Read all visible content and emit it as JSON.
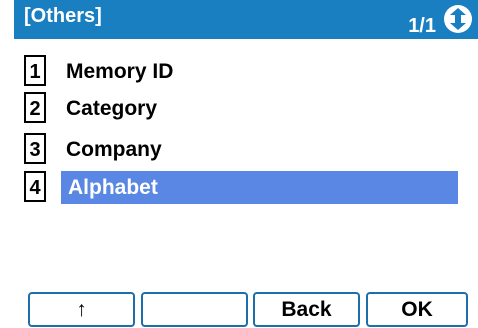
{
  "header": {
    "title": "[Others]",
    "page_indicator": "1/1",
    "scroll_icon": "up-down-scroll-icon"
  },
  "menu": {
    "items": [
      {
        "number": "1",
        "label": "Memory ID",
        "selected": false
      },
      {
        "number": "2",
        "label": "Category",
        "selected": false
      },
      {
        "number": "3",
        "label": "Company",
        "selected": false
      },
      {
        "number": "4",
        "label": "Alphabet",
        "selected": true
      }
    ]
  },
  "softkeys": [
    {
      "label": "↑"
    },
    {
      "label": ""
    },
    {
      "label": "Back"
    },
    {
      "label": "OK"
    }
  ],
  "colors": {
    "header_bg": "#1a7fc0",
    "selection_bg": "#5a87e3",
    "softkey_border": "#1d6eaa"
  }
}
